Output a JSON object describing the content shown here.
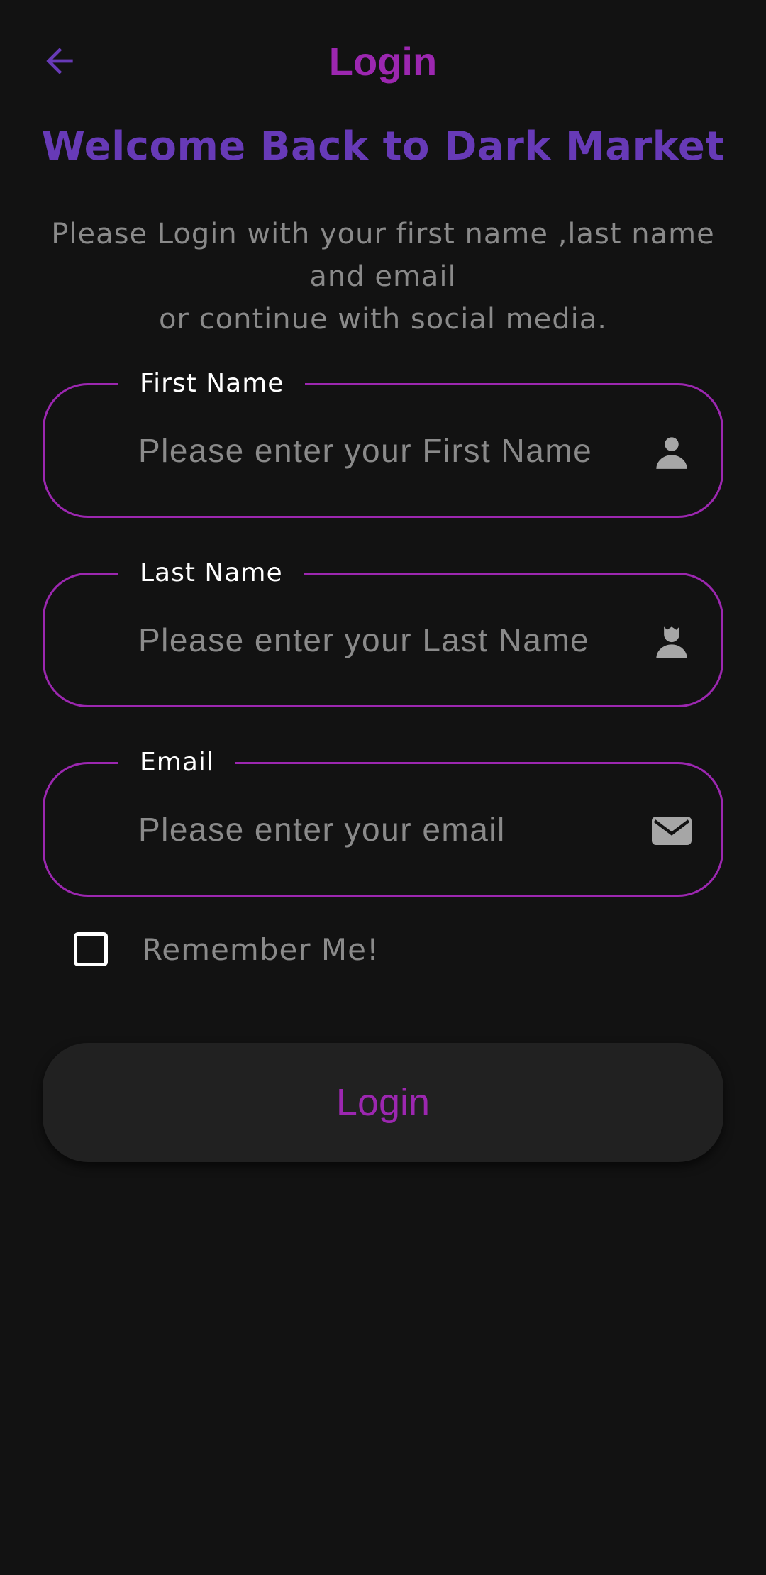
{
  "colors": {
    "accent": "#9C27B0",
    "heading": "#673AB7",
    "background": "#121212",
    "muted_text": "#8a8a8a",
    "button_bg": "#212121"
  },
  "appbar": {
    "title": "Login",
    "back_icon": "arrow-back-icon"
  },
  "welcome": {
    "title": "Welcome Back to Dark Market",
    "subtitle_lines": [
      "Please Login with your first name ,last name",
      "and email",
      "or continue with social media."
    ]
  },
  "form": {
    "first_name": {
      "label": "First Name",
      "placeholder": "Please enter your First Name",
      "value": "",
      "icon": "person-icon"
    },
    "last_name": {
      "label": "Last Name",
      "placeholder": "Please enter your Last Name",
      "value": "",
      "icon": "person-icon"
    },
    "email": {
      "label": "Email",
      "placeholder": "Please enter your email",
      "value": "",
      "icon": "mail-icon"
    },
    "remember_me": {
      "label": "Remember Me!",
      "checked": false
    },
    "submit_label": "Login"
  }
}
